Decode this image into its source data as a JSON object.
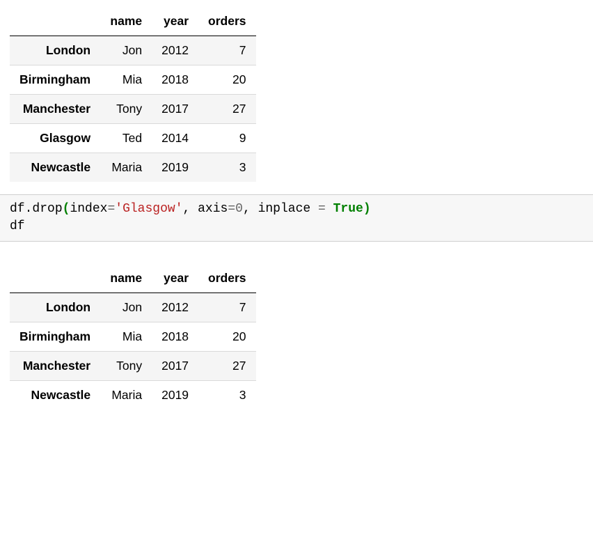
{
  "table1": {
    "columns": {
      "index": "",
      "name": "name",
      "year": "year",
      "orders": "orders"
    },
    "rows": [
      {
        "index": "London",
        "name": "Jon",
        "year": "2012",
        "orders": "7"
      },
      {
        "index": "Birmingham",
        "name": "Mia",
        "year": "2018",
        "orders": "20"
      },
      {
        "index": "Manchester",
        "name": "Tony",
        "year": "2017",
        "orders": "27"
      },
      {
        "index": "Glasgow",
        "name": "Ted",
        "year": "2014",
        "orders": "9"
      },
      {
        "index": "Newcastle",
        "name": "Maria",
        "year": "2019",
        "orders": "3"
      }
    ]
  },
  "code": {
    "obj": "df",
    "dot": ".",
    "method": "drop",
    "popen": "(",
    "kw_index": "index",
    "eq1": "=",
    "str_glasgow": "'Glasgow'",
    "comma1": ",",
    "kw_axis": " axis",
    "eq2": "=",
    "num_zero": "0",
    "comma2": ",",
    "kw_inplace": " inplace ",
    "eq3": "= ",
    "kw_true": "True",
    "pclose": ")",
    "line2": "df"
  },
  "table2": {
    "columns": {
      "index": "",
      "name": "name",
      "year": "year",
      "orders": "orders"
    },
    "rows": [
      {
        "index": "London",
        "name": "Jon",
        "year": "2012",
        "orders": "7"
      },
      {
        "index": "Birmingham",
        "name": "Mia",
        "year": "2018",
        "orders": "20"
      },
      {
        "index": "Manchester",
        "name": "Tony",
        "year": "2017",
        "orders": "27"
      },
      {
        "index": "Newcastle",
        "name": "Maria",
        "year": "2019",
        "orders": "3"
      }
    ]
  }
}
